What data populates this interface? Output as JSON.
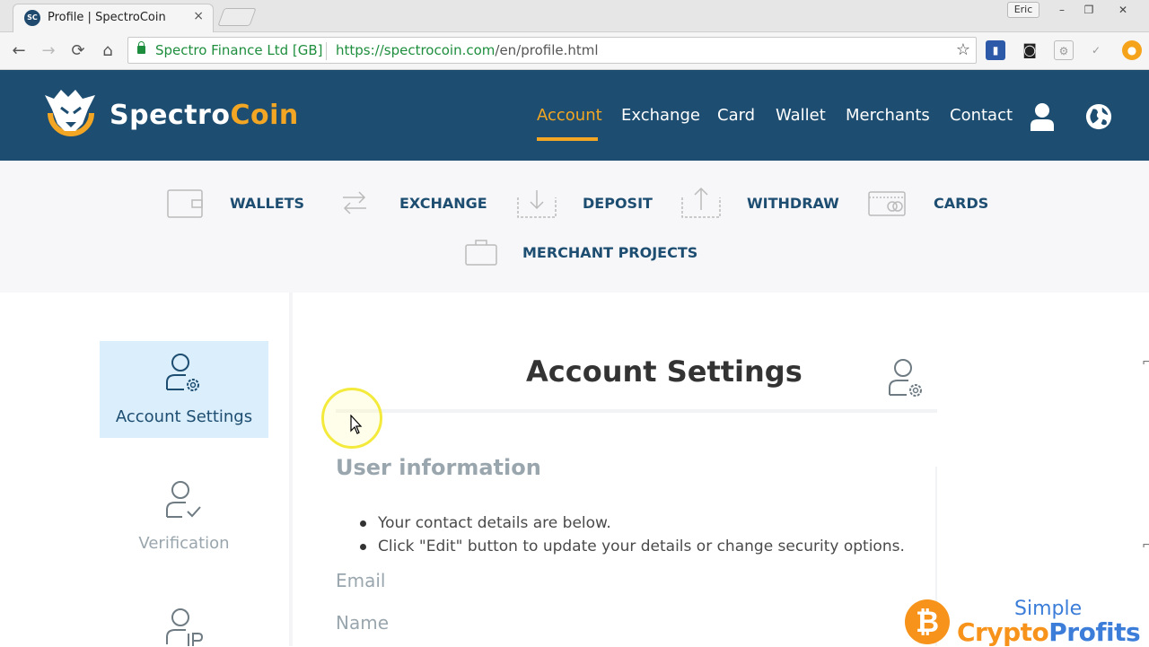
{
  "browser": {
    "tab_title": "Profile | SpectroCoin",
    "tab_favicon_text": "SC",
    "tab_close": "×",
    "user_chip": "Eric",
    "window_controls": [
      "–",
      "❐",
      "✕"
    ],
    "ev_certificate": "Spectro Finance Ltd [GB]",
    "url_host": "https://spectrocoin.com",
    "url_path": "/en/profile.html",
    "icons": [
      "back-icon",
      "forward-icon",
      "reload-icon",
      "home-icon",
      "lock-icon",
      "star-icon"
    ]
  },
  "header": {
    "logo_spectro": "Spectro",
    "logo_coin": "Coin",
    "nav": [
      "Account",
      "Exchange",
      "Card",
      "Wallet",
      "Merchants",
      "Contact"
    ],
    "active_nav": "Account",
    "accent_color": "#f2a623",
    "brand_color": "#1d4d70"
  },
  "subnav": {
    "wallets": "WALLETS",
    "exchange": "EXCHANGE",
    "deposit": "DEPOSIT",
    "withdraw": "WITHDRAW",
    "cards": "CARDS",
    "merchant_projects": "MERCHANT PROJECTS"
  },
  "sidebar": {
    "account_settings": "Account Settings",
    "verification": "Verification"
  },
  "main": {
    "title": "Account Settings",
    "section_title": "User information",
    "bullets": [
      "Your contact details are below.",
      "Click \"Edit\" button to update your details or change security options."
    ],
    "email_label": "Email",
    "name_label": "Name"
  },
  "watermark": {
    "coin_symbol": "₿",
    "line1": "Simple",
    "line2_a": "Crypto",
    "line2_b": "Profits"
  }
}
